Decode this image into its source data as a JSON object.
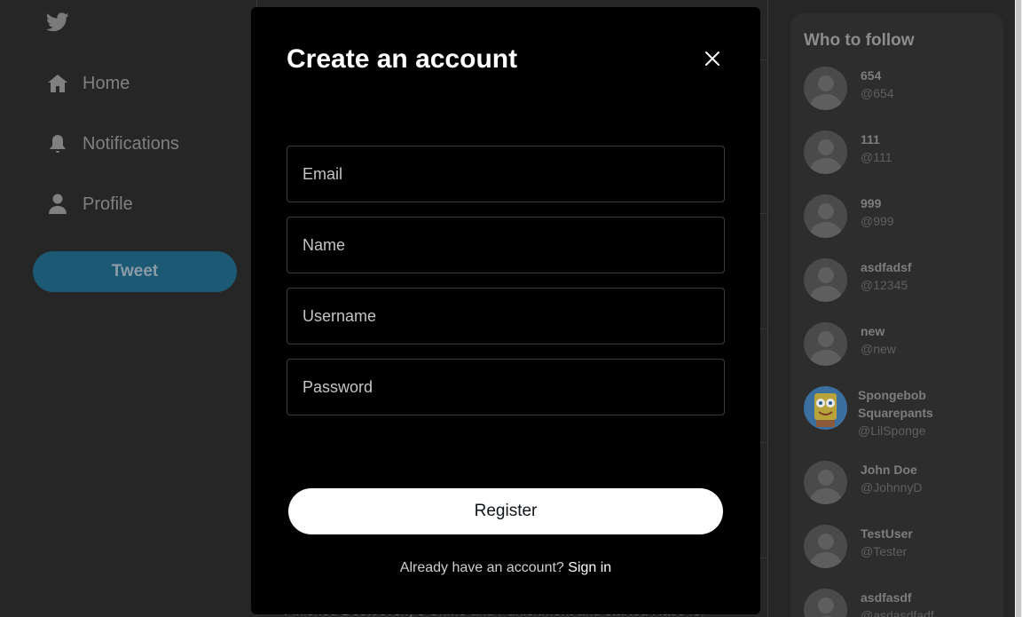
{
  "sidebar": {
    "logo": "twitter-bird-icon",
    "items": [
      {
        "label": "Home",
        "icon": "home-icon"
      },
      {
        "label": "Notifications",
        "icon": "bell-icon"
      },
      {
        "label": "Profile",
        "icon": "person-icon"
      }
    ],
    "tweet_label": "Tweet"
  },
  "feed": {
    "peek_text": "Finished Dostoevsky's Crime and Punishment and started Race for"
  },
  "who_to_follow": {
    "title": "Who to follow",
    "users": [
      {
        "name": "654",
        "handle": "@654"
      },
      {
        "name": "111",
        "handle": "@111"
      },
      {
        "name": "999",
        "handle": "@999"
      },
      {
        "name": "asdfadsf",
        "handle": "@12345"
      },
      {
        "name": "new",
        "handle": "@new"
      },
      {
        "name": "Spongebob Squarepants",
        "handle": "@LilSponge"
      },
      {
        "name": "John Doe",
        "handle": "@JohnnyD"
      },
      {
        "name": "TestUser",
        "handle": "@Tester"
      },
      {
        "name": "asdfasdf",
        "handle": "@asdasdfadf"
      }
    ]
  },
  "modal": {
    "title": "Create an account",
    "close_icon": "close-icon",
    "fields": {
      "email_placeholder": "Email",
      "name_placeholder": "Name",
      "username_placeholder": "Username",
      "password_placeholder": "Password"
    },
    "register_label": "Register",
    "signin_prompt": "Already have an account?",
    "signin_link": "Sign in"
  },
  "colors": {
    "modal_bg": "#000000",
    "page_bg": "#262626",
    "accent": "#1c5975"
  }
}
